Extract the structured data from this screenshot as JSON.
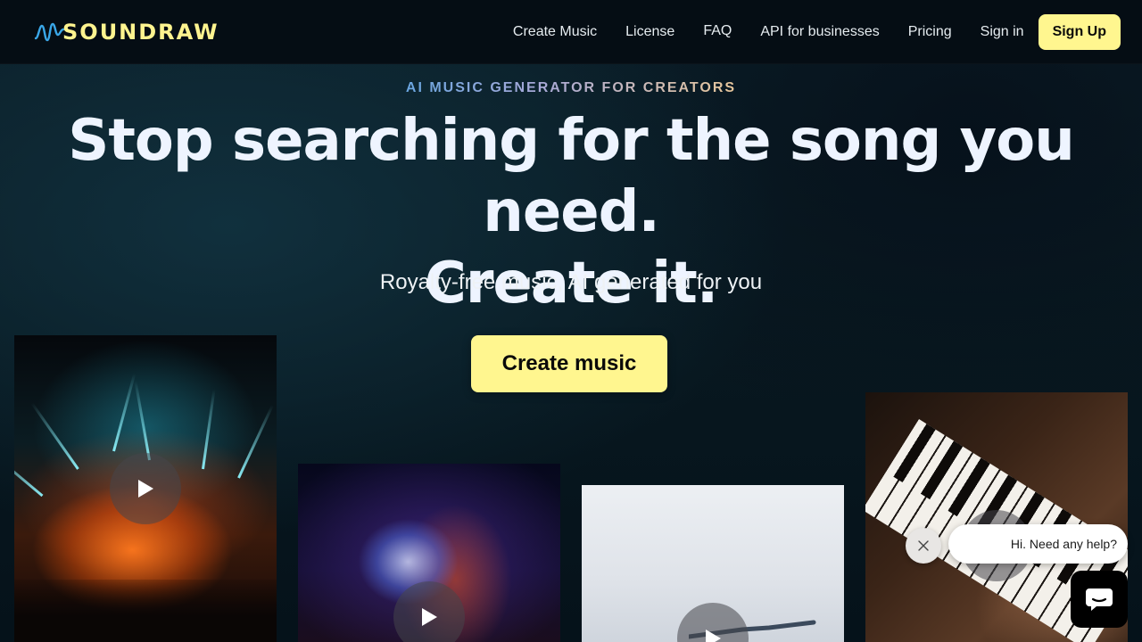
{
  "brand": {
    "name": "SOUNDRAW",
    "color": "#fff48f"
  },
  "nav": {
    "items": [
      {
        "label": "Create Music"
      },
      {
        "label": "License"
      },
      {
        "label": "FAQ"
      },
      {
        "label": "API for businesses"
      },
      {
        "label": "Pricing"
      }
    ],
    "signin": "Sign in",
    "signup": "Sign Up"
  },
  "hero": {
    "eyebrow": "AI MUSIC GENERATOR FOR CREATORS",
    "headline_line1": "Stop searching for the song you need.",
    "headline_line2": "Create it.",
    "subhead": "Royalty-free music, AI generated for you",
    "cta": "Create music"
  },
  "cards": [
    {
      "name": "concert-card",
      "icon": "play-icon"
    },
    {
      "name": "disco-card",
      "icon": "play-icon"
    },
    {
      "name": "dancer-card",
      "icon": "play-icon"
    },
    {
      "name": "piano-card",
      "icon": "play-icon"
    }
  ],
  "chat": {
    "message": "Hi. Need any help?",
    "close_icon": "close-icon",
    "launcher_icon": "chat-icon"
  },
  "colors": {
    "accent": "#fff68f",
    "background": "#07141c"
  }
}
